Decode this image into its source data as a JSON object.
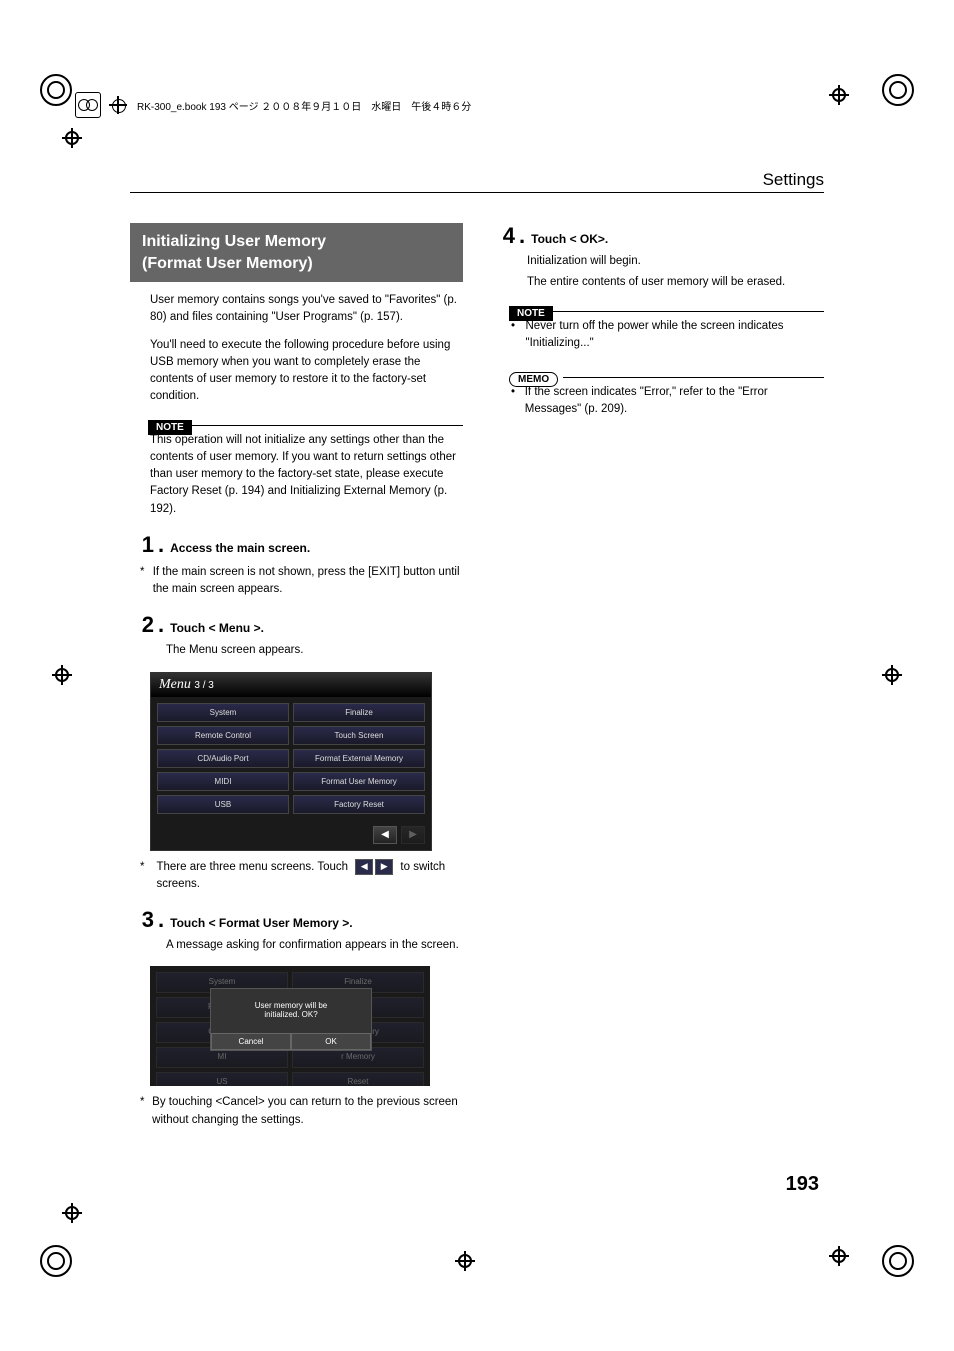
{
  "header": {
    "runhead": "RK-300_e.book  193 ページ  ２００８年９月１０日　水曜日　午後４時６分"
  },
  "page": {
    "title": "Settings",
    "number": "193"
  },
  "left": {
    "sectionTitleL1": "Initializing User Memory",
    "sectionTitleL2": "(Format User Memory)",
    "intro1": "User memory contains songs you've saved to \"Favorites\" (p. 80) and files containing \"User Programs\" (p. 157).",
    "intro2": "You'll need to execute the following procedure before using USB memory when you want to completely erase the contents of user memory to restore it to the factory-set condition.",
    "noteLabel": "NOTE",
    "note1": "This operation will not initialize any settings other than the contents of user memory. If you want to return settings other than user memory to the factory-set state, please execute Factory Reset (p. 194) and Initializing External Memory (p. 192).",
    "step1": {
      "n": "1",
      "title": "Access the main screen."
    },
    "step1note": "If the main screen is not shown, press the [EXIT] button until the main screen appears.",
    "step2": {
      "n": "2",
      "title": "Touch < Menu >."
    },
    "step2body": "The Menu screen appears.",
    "menu": {
      "title": "Menu",
      "page": "3 / 3",
      "buttons": [
        "System",
        "Finalize",
        "Remote Control",
        "Touch Screen",
        "CD/Audio Port",
        "Format External Memory",
        "MIDI",
        "Format User Memory",
        "USB",
        "Factory Reset"
      ]
    },
    "step2note_a": "There are three menu screens. Touch",
    "step2note_b": "to switch screens.",
    "step3": {
      "n": "3",
      "title": "Touch < Format User Memory >."
    },
    "step3body": "A message asking for confirmation appears in the screen.",
    "dialog": {
      "msg1": "User memory will be",
      "msg2": "initialized. OK?",
      "cancel": "Cancel",
      "ok": "OK",
      "bgLeft": [
        "System",
        "Remote",
        "CD/Auc",
        "MI",
        "US"
      ],
      "bgRight": [
        "Finalize",
        "Screen",
        "nal Memory",
        "r Memory",
        "Reset"
      ]
    },
    "step3note": "By touching <Cancel> you can return to the previous screen without changing the settings."
  },
  "right": {
    "step4": {
      "n": "4",
      "title": "Touch < OK>."
    },
    "step4body1": "Initialization will begin.",
    "step4body2": "The entire contents of user memory will be erased.",
    "noteLabel": "NOTE",
    "noteBullet": "Never turn off the power while the screen indicates \"Initializing...\"",
    "memoLabel": "MEMO",
    "memoBullet": "If the screen indicates \"Error,\" refer to the \"Error Messages\" (p. 209)."
  }
}
